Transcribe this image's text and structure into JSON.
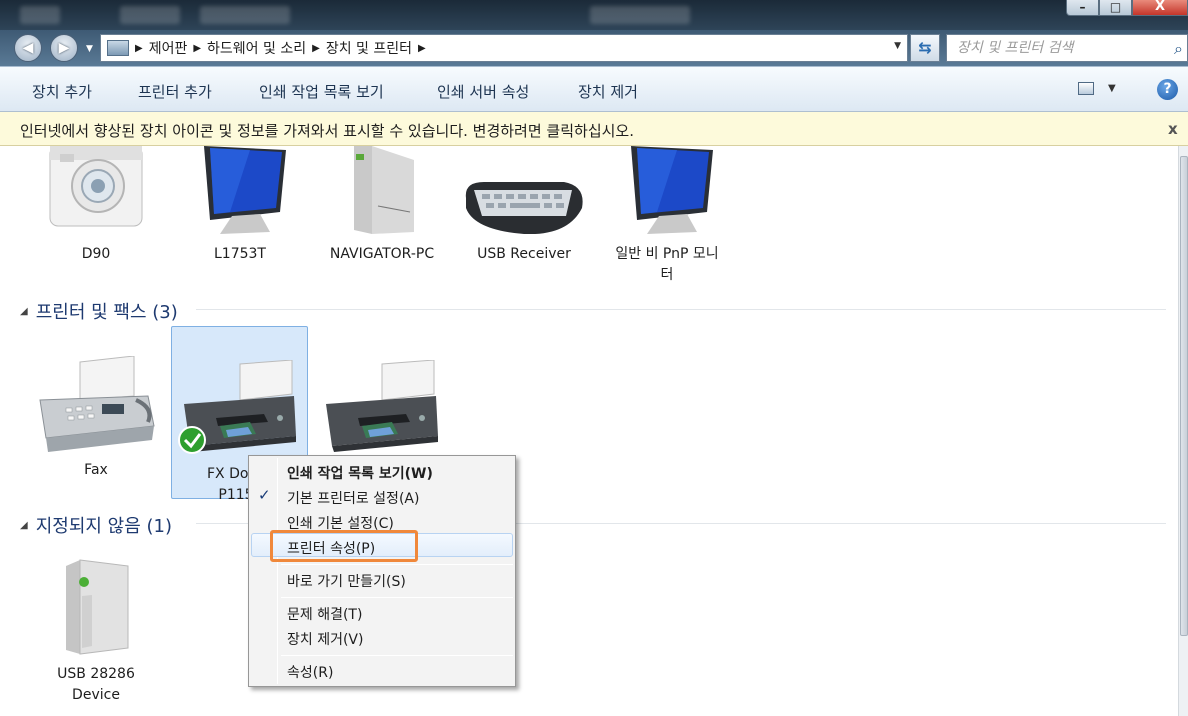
{
  "titlebar": {
    "close_glyph": "X"
  },
  "nav": {
    "breadcrumbs": [
      "제어판",
      "하드웨어 및 소리",
      "장치 및 프린터"
    ],
    "search_placeholder": "장치 및 프린터 검색"
  },
  "toolbar": {
    "add_device": "장치 추가",
    "add_printer": "프린터 추가",
    "see_print_queue": "인쇄 작업 목록 보기",
    "print_server_props": "인쇄 서버 속성",
    "remove_device": "장치 제거",
    "help": "?"
  },
  "infobar": {
    "message": "인터넷에서 향상된 장치 아이콘 및 정보를 가져와서 표시할 수 있습니다. 변경하려면 클릭하십시오.",
    "close": "x"
  },
  "devices": [
    {
      "label": "D90"
    },
    {
      "label": "L1753T"
    },
    {
      "label": "NAVIGATOR-PC"
    },
    {
      "label": "USB Receiver"
    },
    {
      "label": "일반 비 PnP 모니\n터"
    }
  ],
  "printers_group": {
    "title": "프린터 및 팩스 (3)",
    "items": [
      {
        "label": "Fax"
      },
      {
        "label": "FX Docu\nP115"
      }
    ]
  },
  "unspecified_group": {
    "title": "지정되지 않음 (1)",
    "items": [
      {
        "label": "USB 28286\nDevice"
      }
    ]
  },
  "context_menu": {
    "items": [
      "인쇄 작업 목록 보기(W)",
      "기본 프린터로 설정(A)",
      "인쇄 기본 설정(C)",
      "프린터 속성(P)",
      "바로 가기 만들기(S)",
      "문제 해결(T)",
      "장치 제거(V)",
      "속성(R)"
    ],
    "check_glyph": "✓"
  },
  "colors": {
    "highlight_box": "#f0883b",
    "selection": "#d7e8fa",
    "group_title": "#1e3a70"
  }
}
